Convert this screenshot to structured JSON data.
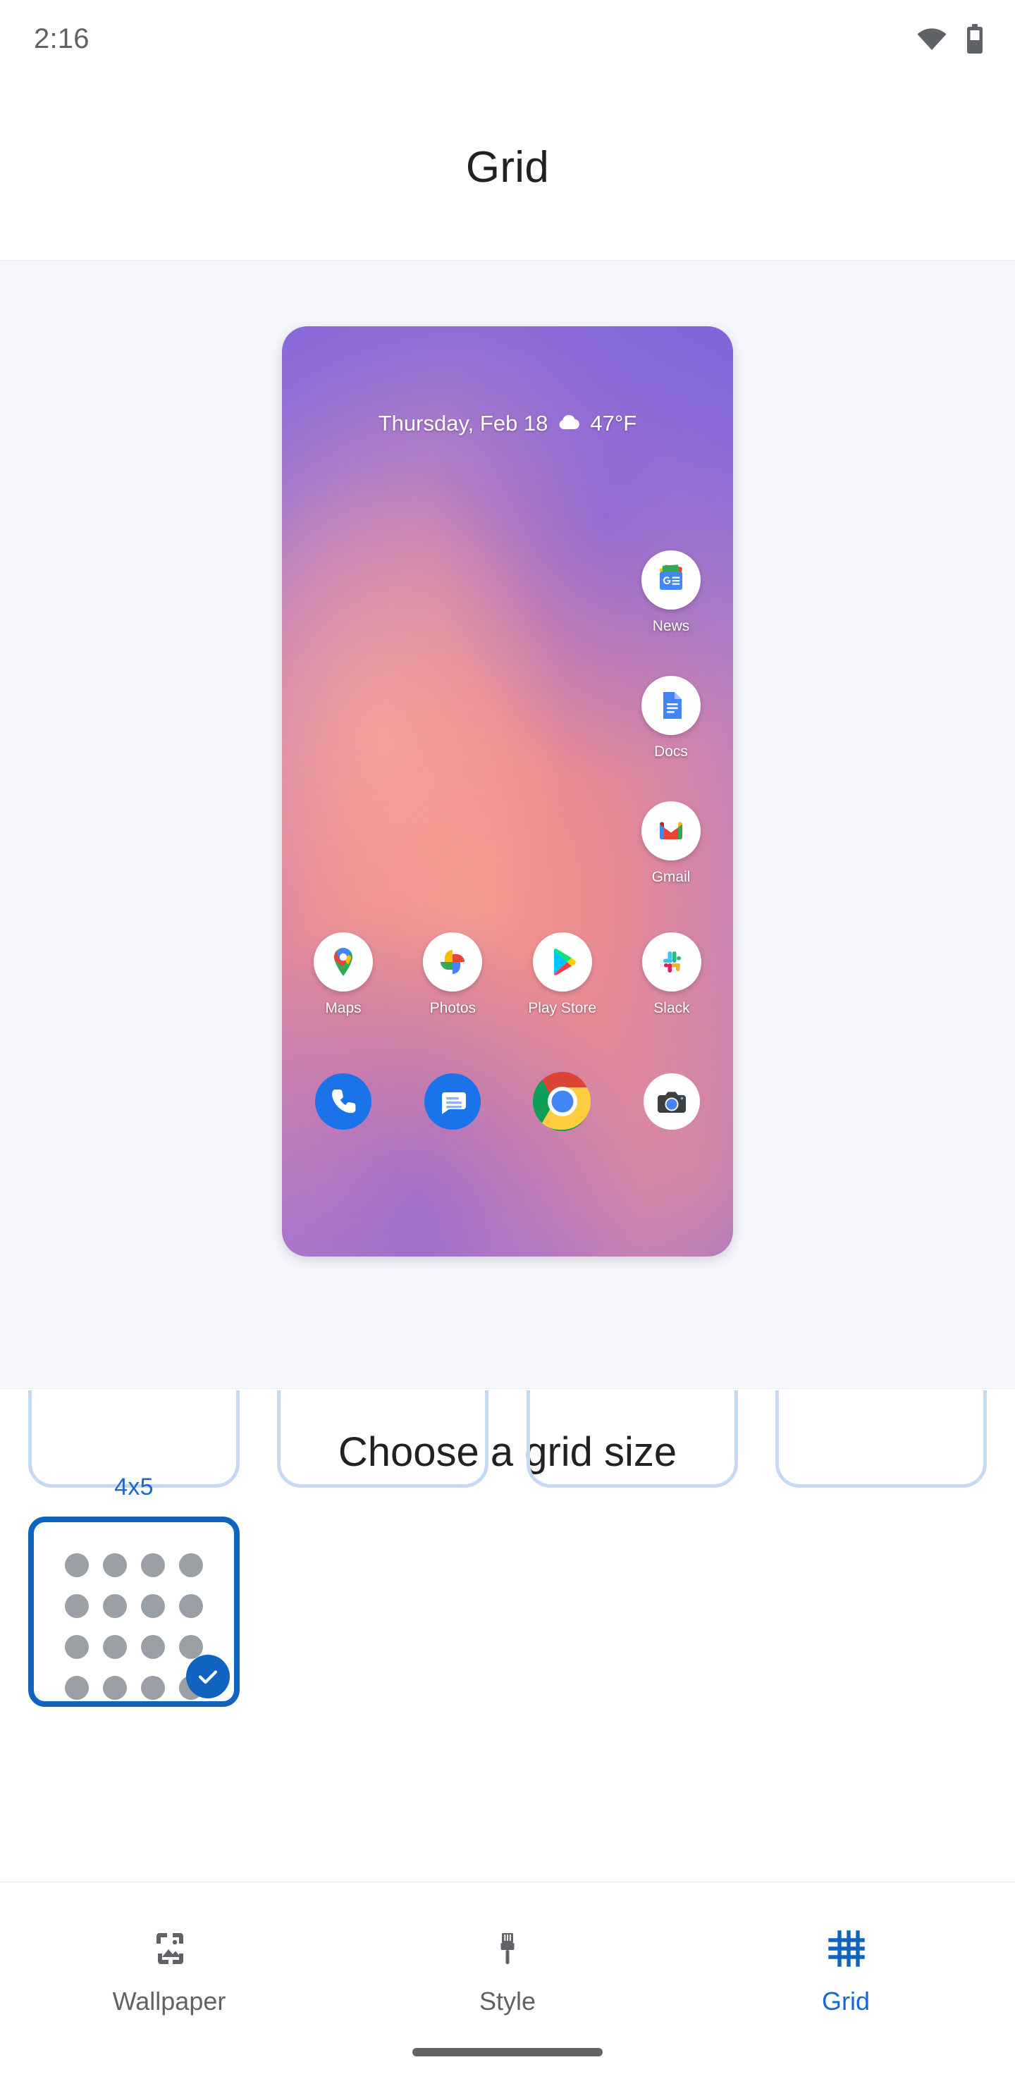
{
  "status_bar": {
    "time": "2:16",
    "wifi_icon": "wifi-icon",
    "battery_icon": "battery-icon"
  },
  "app_bar": {
    "title": "Grid"
  },
  "preview": {
    "widget": {
      "date": "Thursday, Feb 18",
      "weather_icon": "cloud-icon",
      "temperature": "47°F"
    },
    "right_column_apps": [
      {
        "label": "News",
        "icon": "google-news-icon"
      },
      {
        "label": "Docs",
        "icon": "google-docs-icon"
      },
      {
        "label": "Gmail",
        "icon": "gmail-icon"
      }
    ],
    "app_row": [
      {
        "label": "Maps",
        "icon": "google-maps-icon"
      },
      {
        "label": "Photos",
        "icon": "google-photos-icon"
      },
      {
        "label": "Play Store",
        "icon": "google-play-store-icon"
      },
      {
        "label": "Slack",
        "icon": "slack-icon"
      }
    ],
    "dock_row": [
      {
        "label": "Phone",
        "icon": "phone-icon"
      },
      {
        "label": "Messages",
        "icon": "messages-icon"
      },
      {
        "label": "Chrome",
        "icon": "chrome-icon"
      },
      {
        "label": "Camera",
        "icon": "camera-icon"
      }
    ]
  },
  "picker": {
    "heading": "Choose a grid size",
    "ghost_cards": 4,
    "options": [
      {
        "label": "4x5",
        "columns": 4,
        "rows": 5,
        "visible_rows": 4,
        "selected": true,
        "check_icon": "check-icon"
      }
    ]
  },
  "bottom_nav": {
    "items": [
      {
        "label": "Wallpaper",
        "icon": "wallpaper-icon",
        "active": false
      },
      {
        "label": "Style",
        "icon": "paintbrush-icon",
        "active": false
      },
      {
        "label": "Grid",
        "icon": "grid-icon",
        "active": true
      }
    ]
  },
  "colors": {
    "accent": "#1967d2",
    "selected_border": "#1064c0",
    "ghost_border": "#c5d9f2",
    "dot": "#9aa0a6",
    "text_primary": "#202124",
    "text_secondary": "#5f6368",
    "preview_bg": "#f5f7fa"
  },
  "gesture_bar": "home-indicator"
}
